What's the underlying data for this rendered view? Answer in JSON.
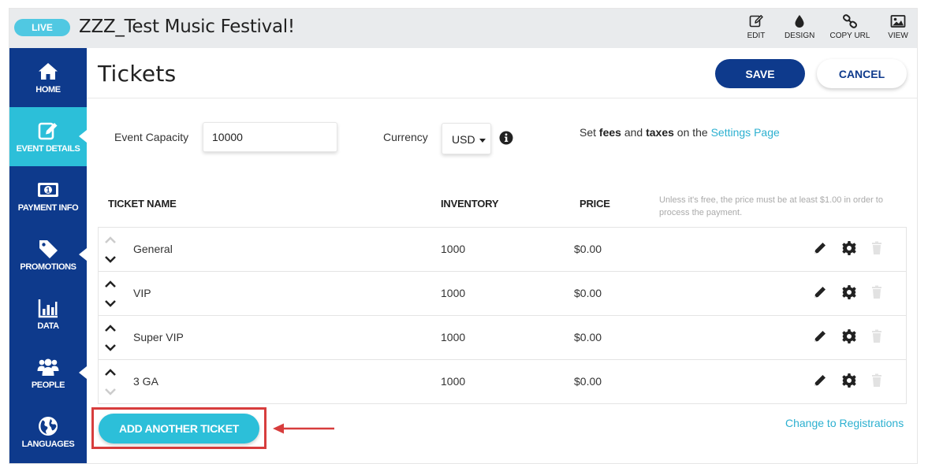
{
  "header": {
    "live_badge": "LIVE",
    "event_title": "ZZZ_Test Music Festival!",
    "tools": [
      {
        "label": "EDIT",
        "icon": "edit-icon"
      },
      {
        "label": "DESIGN",
        "icon": "droplet-icon"
      },
      {
        "label": "COPY URL",
        "icon": "link-icon"
      },
      {
        "label": "VIEW",
        "icon": "image-icon"
      }
    ]
  },
  "sidebar": {
    "items": [
      {
        "label": "HOME",
        "icon": "home-icon",
        "active": false
      },
      {
        "label": "EVENT DETAILS",
        "icon": "edit-icon",
        "active": true
      },
      {
        "label": "PAYMENT INFO",
        "icon": "money-icon",
        "active": false
      },
      {
        "label": "PROMOTIONS",
        "icon": "tag-icon",
        "active": false
      },
      {
        "label": "DATA",
        "icon": "bar-chart-icon",
        "active": false
      },
      {
        "label": "PEOPLE",
        "icon": "people-icon",
        "active": false
      },
      {
        "label": "LANGUAGES",
        "icon": "globe-icon",
        "active": false
      }
    ]
  },
  "page": {
    "title": "Tickets",
    "save_label": "SAVE",
    "cancel_label": "CANCEL"
  },
  "settings": {
    "capacity_label": "Event Capacity",
    "capacity_value": "10000",
    "currency_label": "Currency",
    "currency_value": "USD",
    "fees_prefix": "Set ",
    "fees_bold1": "fees",
    "fees_and": " and ",
    "fees_bold2": "taxes",
    "fees_suffix": " on the ",
    "settings_link": "Settings Page"
  },
  "table": {
    "headers": {
      "name": "TICKET NAME",
      "inventory": "INVENTORY",
      "price": "PRICE"
    },
    "price_note": "Unless it's free, the price must be at least $1.00 in order to process the payment.",
    "rows": [
      {
        "name": "General",
        "inventory": "1000",
        "price": "$0.00"
      },
      {
        "name": "VIP",
        "inventory": "1000",
        "price": "$0.00"
      },
      {
        "name": "Super VIP",
        "inventory": "1000",
        "price": "$0.00"
      },
      {
        "name": "3 GA",
        "inventory": "1000",
        "price": "$0.00"
      }
    ]
  },
  "footer": {
    "add_ticket_label": "ADD ANOTHER TICKET",
    "change_link": "Change to Registrations"
  },
  "colors": {
    "navy": "#0e3a8c",
    "cyan": "#2cbfd9",
    "link": "#2cb0d0",
    "highlight_red": "#d73d3d"
  }
}
